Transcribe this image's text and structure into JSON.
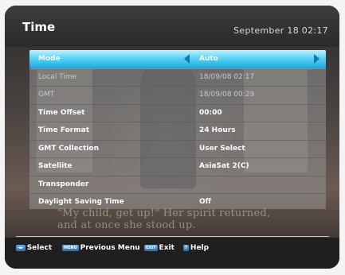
{
  "header": {
    "title": "Time",
    "clock": "September 18 02:17"
  },
  "menu": {
    "rows": [
      {
        "label": "Mode",
        "value": "Auto",
        "state": "selected"
      },
      {
        "label": "Local Time",
        "value": "18/09/08 02:17",
        "state": "disabled"
      },
      {
        "label": "GMT",
        "value": "18/09/08 00:29",
        "state": "disabled"
      },
      {
        "label": "Time Offset",
        "value": "00:00",
        "state": "normal"
      },
      {
        "label": "Time Format",
        "value": "24 Hours",
        "state": "normal"
      },
      {
        "label": "GMT Collection",
        "value": "User Select",
        "state": "normal"
      },
      {
        "label": "Satellite",
        "value": "AsiaSat 2(C)",
        "state": "normal"
      },
      {
        "label": "Transponder",
        "value": "",
        "state": "normal"
      },
      {
        "label": "Daylight Saving Time",
        "value": "Off",
        "state": "normal"
      }
    ]
  },
  "background_subtitle": {
    "line1": "\"My child, get up!\" Her spirit returned,",
    "line2": "and at once she stood up."
  },
  "help": [
    {
      "key": "◄►",
      "label": "Select"
    },
    {
      "key": "MENU",
      "label": "Previous Menu"
    },
    {
      "key": "EXIT",
      "label": "Exit"
    },
    {
      "key": "?",
      "label": "Help"
    }
  ],
  "colors": {
    "highlight": "#1aa6dc",
    "arrow": "#1477b0",
    "panel": "#969696"
  }
}
